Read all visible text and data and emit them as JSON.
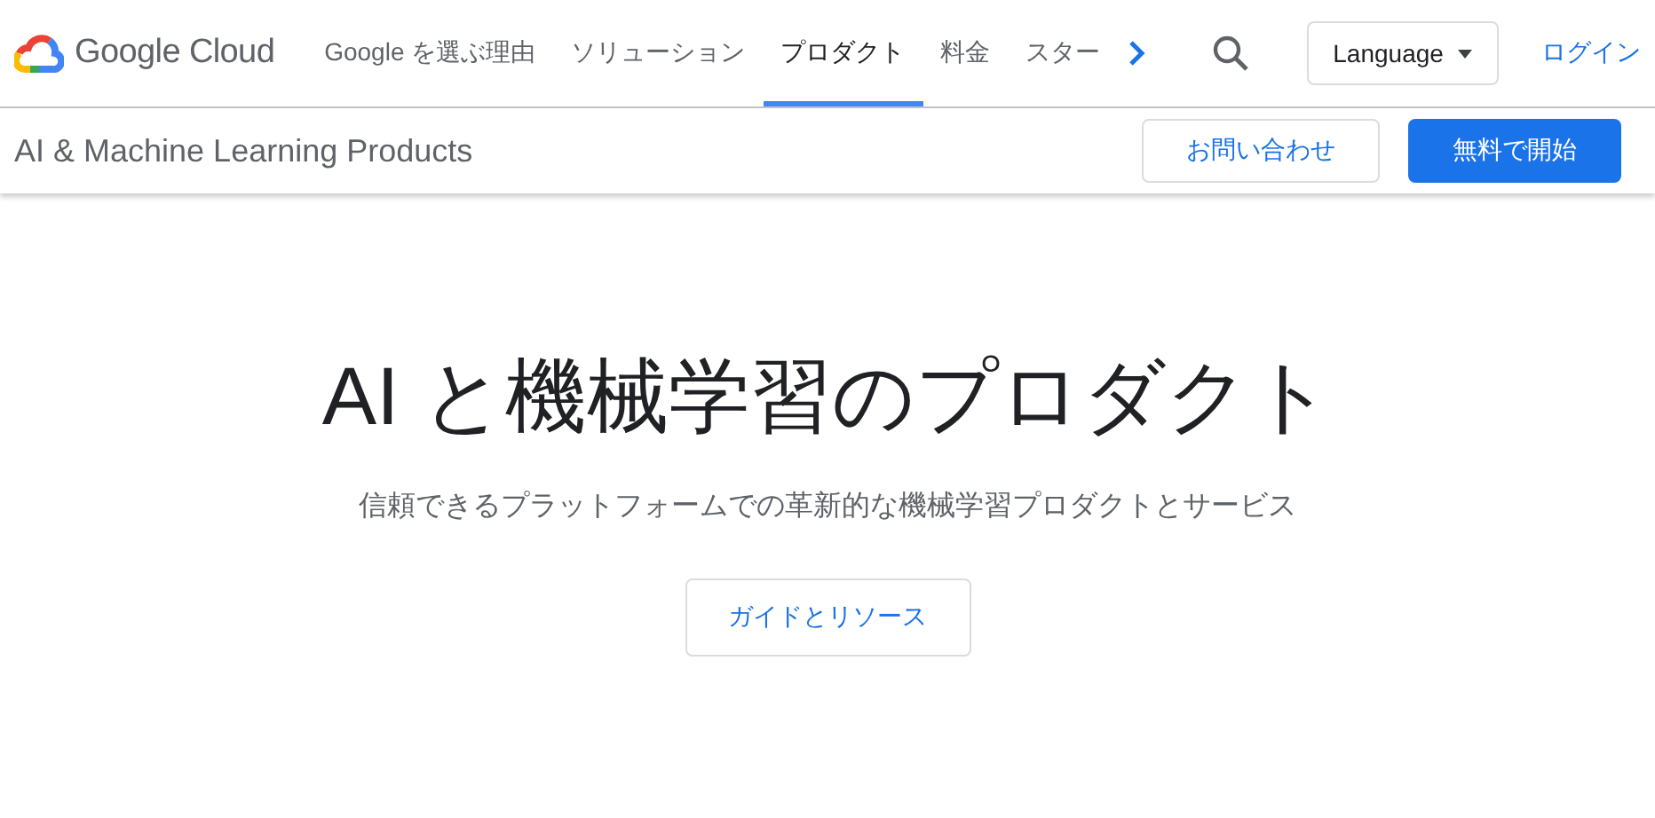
{
  "header": {
    "brand": "Google Cloud",
    "nav": [
      {
        "label": "Google を選ぶ理由",
        "selected": false
      },
      {
        "label": "ソリューション",
        "selected": false
      },
      {
        "label": "プロダクト",
        "selected": true
      },
      {
        "label": "料金",
        "selected": false
      },
      {
        "label": "スター",
        "selected": false
      }
    ],
    "language": "Language",
    "login": "ログイン"
  },
  "subheader": {
    "title": "AI & Machine Learning Products",
    "contact": "お問い合わせ",
    "start": "無料で開始"
  },
  "hero": {
    "title": "AI と機械学習のプロダクト",
    "subtitle": "信頼できるプラットフォームでの革新的な機械学習プロダクトとサービス",
    "button": "ガイドとリソース"
  }
}
